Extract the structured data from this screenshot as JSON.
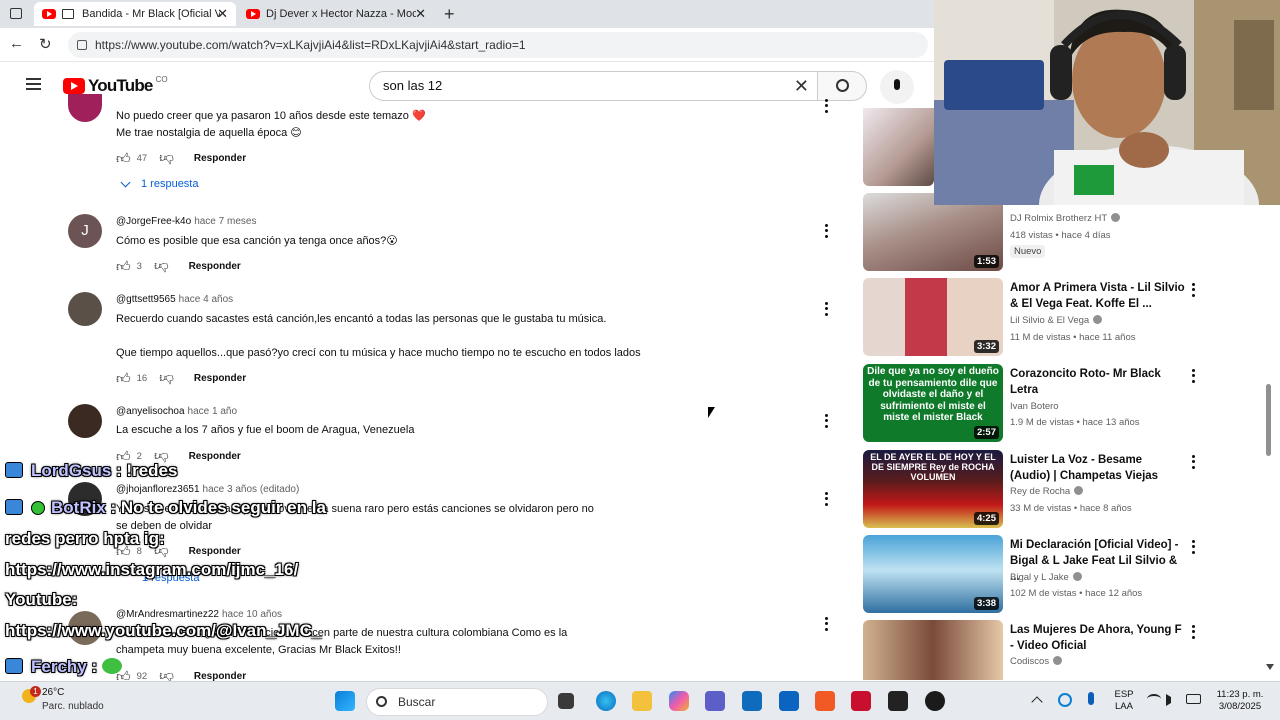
{
  "browser": {
    "tabs": [
      {
        "title": "Bandida - Mr Black [Oficial V",
        "active": true
      },
      {
        "title": "Dj Dever x Hector Nazza - Mocca",
        "active": false
      }
    ],
    "url": "https://www.youtube.com/watch?v=xLKajvjiAi4&list=RDxLKajvjiAi4&start_radio=1"
  },
  "youtube": {
    "logo_text": "YouTube",
    "country": "CO",
    "search_query": "son las 12"
  },
  "comments": [
    {
      "author": "",
      "time": "",
      "avatar": "",
      "text": [
        "No puedo creer que ya pasaron 10 años  desde este temazo ❤️",
        "Me trae nostalgia de aquella época 😊"
      ],
      "likes": "47",
      "reply_label": "Responder",
      "replies_label": "1 respuesta"
    },
    {
      "author": "@JorgeFree-k4o",
      "time": "hace 7 meses",
      "avatar": "J",
      "text": [
        "Cómo es posible que esa canción ya tenga once años?😮"
      ],
      "likes": "3",
      "reply_label": "Responder"
    },
    {
      "author": "@gttsett9565",
      "time": "hace 4 años",
      "avatar": "",
      "text": [
        "Recuerdo cuando sacastes está canción,les encantó a todas las personas que le gustaba tu música.",
        "",
        "Que tiempo aquellos...que pasó?yo crecí con tu música y hace mucho tiempo no te escucho en todos lados"
      ],
      "likes": "16",
      "reply_label": "Responder"
    },
    {
      "author": "@anyelisochoa",
      "time": "hace 1 año",
      "avatar": "",
      "text": [
        "La escuche a los 7 años y fue el boom de Aragua, Venezuela"
      ],
      "likes": "2",
      "reply_label": "Responder"
    },
    {
      "author": "@jhojanflorez3651",
      "time": "hace 3 años (editado)",
      "avatar": "",
      "text": [
        "Yo desde el 2015 sabían que el covid venía suena raro pero estás canciones se olvidaron pero no",
        "se deben de olvidar"
      ],
      "likes": "8",
      "reply_label": "Responder",
      "replies_label": "1 respuesta"
    },
    {
      "author": "@MrAndresmartinez22",
      "time": "hace 10 años",
      "avatar": "",
      "text": [
        "Bueno todo estas grandes canciones hacen parte de nuestra cultura colombiana Como es la",
        "champeta muy buena excelente, Gracias Mr Black Exitos!!"
      ],
      "likes": "92",
      "reply_label": "Responder"
    }
  ],
  "sidebar": [
    {
      "title": "",
      "channel": "DJ Rolmix Brotherz HT",
      "meta": "418 vistas • hace 4 días",
      "duration": "1:53",
      "badge": "Nuevo"
    },
    {
      "title": "Amor A Primera Vista - Lil Silvio & El Vega Feat. Koffe El ...",
      "channel": "Lil Silvio & El Vega",
      "meta": "11 M de vistas • hace 11 años",
      "duration": "3:32"
    },
    {
      "title": "Corazoncito Roto- Mr Black Letra",
      "channel": "Ivan Botero",
      "meta": "1.9 M de vistas • hace 13 años",
      "duration": "2:57",
      "thumb_text": "Dile que ya no soy el dueño de tu pensamiento dile que olvidaste el daño y el sufrimiento el miste el miste el mister Black"
    },
    {
      "title": "Luister La Voz - Besame (Audio) | Champetas Viejas",
      "channel": "Rey de Rocha",
      "meta": "33 M de vistas • hace 8 años",
      "duration": "4:25",
      "thumb_text": "EL DE AYER EL DE HOY Y EL DE SIEMPRE  Rey de ROCHA  VOLUMEN"
    },
    {
      "title": "Mi Declaración [Oficial Video] - Bigal & L Jake Feat Lil Silvio & ...",
      "channel": "Bigal y L Jake",
      "meta": "102 M de vistas • hace 12 años",
      "duration": "3:38"
    },
    {
      "title": "Las Mujeres De Ahora, Young F - Video Oficial",
      "channel": "Codiscos",
      "meta": "",
      "duration": ""
    }
  ],
  "chat": [
    {
      "user": "LordGsus",
      "message": "!redes"
    },
    {
      "user": "BotRix",
      "message": "No te olvides seguir en la redes perro hpta ig: https://www.instagram.com/ijmc_16/ Youtube: https://www.youtube.com/@Ivan_JMC_"
    },
    {
      "user": "Ferchy",
      "message": ""
    }
  ],
  "chat_lines": {
    "botrix_line1": "No te olvides seguir en la",
    "botrix_line2": "redes perro hpta ig:",
    "botrix_line3": "https://www.instagram.com/ijmc_16/",
    "botrix_line4": "Youtube:",
    "botrix_line5": "https://www.youtube.com/@Ivan_JMC_"
  },
  "taskbar": {
    "weather_temp": "26°C",
    "weather_desc": "Parc. nublado",
    "weather_badge": "1",
    "search_placeholder": "Buscar",
    "lang_top": "ESP",
    "lang_bottom": "LAA",
    "time": "11:23 p. m.",
    "date": "3/08/2025"
  }
}
